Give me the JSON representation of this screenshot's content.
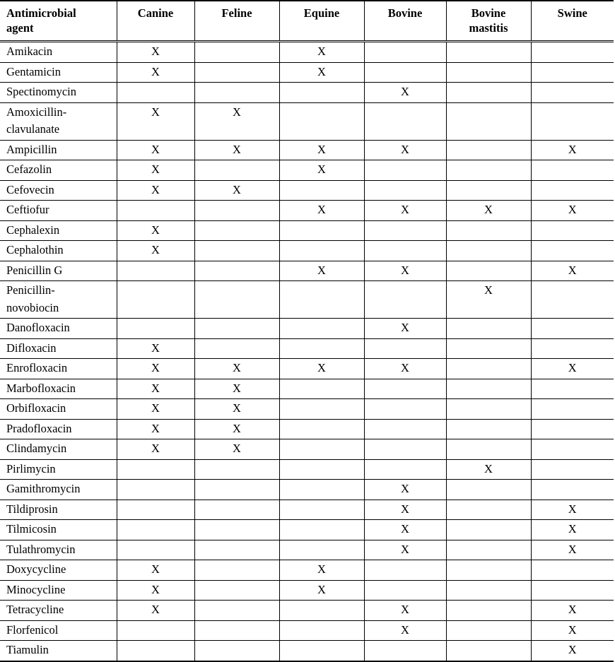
{
  "table": {
    "columns": [
      {
        "key": "agent",
        "label": "Antimicrobial\nagent"
      },
      {
        "key": "canine",
        "label": "Canine"
      },
      {
        "key": "feline",
        "label": "Feline"
      },
      {
        "key": "equine",
        "label": "Equine"
      },
      {
        "key": "bovine",
        "label": "Bovine"
      },
      {
        "key": "mastitis",
        "label": "Bovine\nmastitis"
      },
      {
        "key": "swine",
        "label": "Swine"
      }
    ],
    "mark": "X",
    "empty": "",
    "rows": [
      {
        "agent": "Amikacin",
        "canine": "X",
        "feline": "",
        "equine": "X",
        "bovine": "",
        "mastitis": "",
        "swine": ""
      },
      {
        "agent": "Gentamicin",
        "canine": "X",
        "feline": "",
        "equine": "X",
        "bovine": "",
        "mastitis": "",
        "swine": ""
      },
      {
        "agent": "Spectinomycin",
        "canine": "",
        "feline": "",
        "equine": "",
        "bovine": "X",
        "mastitis": "",
        "swine": ""
      },
      {
        "agent": "Amoxicillin-\nclavulanate",
        "canine": "X",
        "feline": "X",
        "equine": "",
        "bovine": "",
        "mastitis": "",
        "swine": "",
        "tall": true
      },
      {
        "agent": "Ampicillin",
        "canine": "X",
        "feline": "X",
        "equine": "X",
        "bovine": "X",
        "mastitis": "",
        "swine": "X"
      },
      {
        "agent": "Cefazolin",
        "canine": "X",
        "feline": "",
        "equine": "X",
        "bovine": "",
        "mastitis": "",
        "swine": ""
      },
      {
        "agent": "Cefovecin",
        "canine": "X",
        "feline": "X",
        "equine": "",
        "bovine": "",
        "mastitis": "",
        "swine": ""
      },
      {
        "agent": "Ceftiofur",
        "canine": "",
        "feline": "",
        "equine": "X",
        "bovine": "X",
        "mastitis": "X",
        "swine": "X"
      },
      {
        "agent": "Cephalexin",
        "canine": "X",
        "feline": "",
        "equine": "",
        "bovine": "",
        "mastitis": "",
        "swine": ""
      },
      {
        "agent": "Cephalothin",
        "canine": "X",
        "feline": "",
        "equine": "",
        "bovine": "",
        "mastitis": "",
        "swine": ""
      },
      {
        "agent": "Penicillin G",
        "canine": "",
        "feline": "",
        "equine": "X",
        "bovine": "X",
        "mastitis": "",
        "swine": "X"
      },
      {
        "agent": "Penicillin-\nnovobiocin",
        "canine": "",
        "feline": "",
        "equine": "",
        "bovine": "",
        "mastitis": "X",
        "swine": "",
        "tall": true
      },
      {
        "agent": "Danofloxacin",
        "canine": "",
        "feline": "",
        "equine": "",
        "bovine": "X",
        "mastitis": "",
        "swine": ""
      },
      {
        "agent": "Difloxacin",
        "canine": "X",
        "feline": "",
        "equine": "",
        "bovine": "",
        "mastitis": "",
        "swine": ""
      },
      {
        "agent": "Enrofloxacin",
        "canine": "X",
        "feline": "X",
        "equine": "X",
        "bovine": "X",
        "mastitis": "",
        "swine": "X"
      },
      {
        "agent": "Marbofloxacin",
        "canine": "X",
        "feline": "X",
        "equine": "",
        "bovine": "",
        "mastitis": "",
        "swine": ""
      },
      {
        "agent": "Orbifloxacin",
        "canine": "X",
        "feline": "X",
        "equine": "",
        "bovine": "",
        "mastitis": "",
        "swine": ""
      },
      {
        "agent": "Pradofloxacin",
        "canine": "X",
        "feline": "X",
        "equine": "",
        "bovine": "",
        "mastitis": "",
        "swine": ""
      },
      {
        "agent": "Clindamycin",
        "canine": "X",
        "feline": "X",
        "equine": "",
        "bovine": "",
        "mastitis": "",
        "swine": ""
      },
      {
        "agent": "Pirlimycin",
        "canine": "",
        "feline": "",
        "equine": "",
        "bovine": "",
        "mastitis": "X",
        "swine": ""
      },
      {
        "agent": "Gamithromycin",
        "canine": "",
        "feline": "",
        "equine": "",
        "bovine": "X",
        "mastitis": "",
        "swine": ""
      },
      {
        "agent": "Tildiprosin",
        "canine": "",
        "feline": "",
        "equine": "",
        "bovine": "X",
        "mastitis": "",
        "swine": "X"
      },
      {
        "agent": "Tilmicosin",
        "canine": "",
        "feline": "",
        "equine": "",
        "bovine": "X",
        "mastitis": "",
        "swine": "X"
      },
      {
        "agent": "Tulathromycin",
        "canine": "",
        "feline": "",
        "equine": "",
        "bovine": "X",
        "mastitis": "",
        "swine": "X"
      },
      {
        "agent": "Doxycycline",
        "canine": "X",
        "feline": "",
        "equine": "X",
        "bovine": "",
        "mastitis": "",
        "swine": ""
      },
      {
        "agent": "Minocycline",
        "canine": "X",
        "feline": "",
        "equine": "X",
        "bovine": "",
        "mastitis": "",
        "swine": ""
      },
      {
        "agent": "Tetracycline",
        "canine": "X",
        "feline": "",
        "equine": "",
        "bovine": "X",
        "mastitis": "",
        "swine": "X"
      },
      {
        "agent": "Florfenicol",
        "canine": "",
        "feline": "",
        "equine": "",
        "bovine": "X",
        "mastitis": "",
        "swine": "X"
      },
      {
        "agent": "Tiamulin",
        "canine": "",
        "feline": "",
        "equine": "",
        "bovine": "",
        "mastitis": "",
        "swine": "X"
      }
    ]
  }
}
